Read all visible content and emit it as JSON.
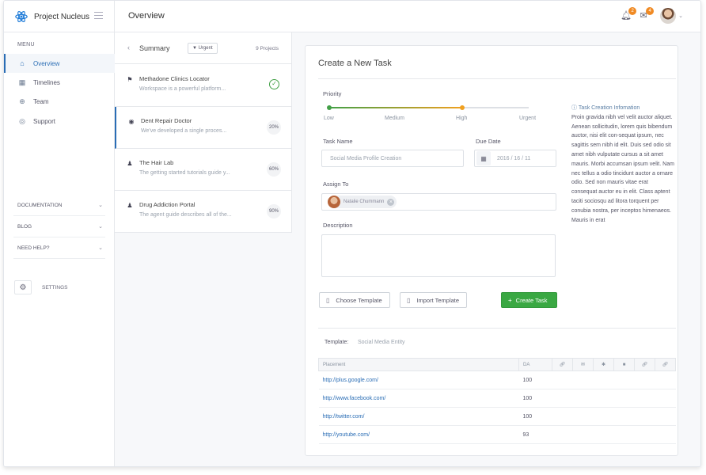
{
  "app": {
    "name": "Project Nucleus",
    "page_title": "Overview"
  },
  "header": {
    "notifications_count": "2",
    "messages_count": "4"
  },
  "sidebar": {
    "menu_label": "MENU",
    "items": [
      {
        "label": "Overview",
        "icon": "home-icon",
        "active": true
      },
      {
        "label": "Timelines",
        "icon": "calendar-icon"
      },
      {
        "label": "Team",
        "icon": "globe-icon"
      },
      {
        "label": "Support",
        "icon": "lifebuoy-icon"
      }
    ],
    "sections": [
      "DOCUMENTATION",
      "BLOG",
      "NEED HELP?"
    ],
    "settings_label": "SETTINGS"
  },
  "summary": {
    "title": "Summary",
    "filter_label": "Urgent",
    "count_label": "9 Projects",
    "projects": [
      {
        "name": "Methadone Clinics Locator",
        "desc": "Workspace is a powerful platform...",
        "status": "done",
        "icon": "flag-icon"
      },
      {
        "name": "Dent Repair Doctor",
        "desc": "We've developed a single proces...",
        "progress": "20%",
        "icon": "target-icon"
      },
      {
        "name": "The Hair Lab",
        "desc": "The getting started tutorials guide y...",
        "progress": "60%",
        "icon": "users-icon"
      },
      {
        "name": "Drug Addiction Portal",
        "desc": "The agent guide describes all of the...",
        "progress": "90%",
        "icon": "users-icon"
      }
    ]
  },
  "task": {
    "title": "Create a New Task",
    "priority_label": "Priority",
    "priority_levels": [
      "Low",
      "Medium",
      "High",
      "Urgent"
    ],
    "priority_value": "High",
    "task_name_label": "Task Name",
    "task_name_value": "Social Media Profile Creation",
    "due_date_label": "Due Date",
    "due_date_value": "2016 / 16 / 11",
    "assign_label": "Assign To",
    "assignee": "Natalie Chummann",
    "description_label": "Description",
    "choose_template": "Choose Template",
    "import_template": "Import Template",
    "create_task": "Create Task",
    "info_title": "Task Creation Infomation",
    "info_text": "Proin gravida nibh vel velit auctor aliquet. Aenean sollicitudin, lorem quis bibendum auctor, nisi elit con-sequat ipsum, nec sagittis sem nibh id elit. Duis sed odio sit amet nibh vulputate cursus a sit amet mauris. Morbi accumsan ipsum velit. Nam nec tellus a odio tincidunt auctor a ornare odio. Sed non  mauris vitae erat consequat auctor eu in elit. Class aptent taciti sociosqu ad litora torquent per conubia nostra, per inceptos himenaeos. Mauris in erat",
    "template_label": "Template:",
    "template_value": "Social Media Entity",
    "table": {
      "headers": [
        "Placement",
        "DA"
      ],
      "icon_columns": [
        "link-icon",
        "mail-icon",
        "star-icon",
        "bookmark-icon",
        "link-icon",
        "link-icon"
      ],
      "rows": [
        {
          "url": "http://plus.google.com/",
          "da": "100"
        },
        {
          "url": "http://www.facebook.com/",
          "da": "100"
        },
        {
          "url": "http://twitter.com/",
          "da": "100"
        },
        {
          "url": "http://youtube.com/",
          "da": "93"
        }
      ]
    }
  }
}
